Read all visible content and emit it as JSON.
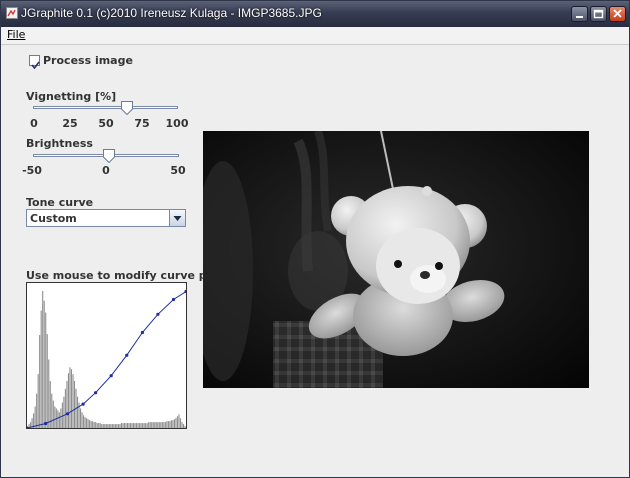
{
  "window": {
    "title": "JGraphite 0.1 (c)2010 Ireneusz Kulaga - IMGP3685.JPG"
  },
  "menu": {
    "file": "File"
  },
  "controls": {
    "process_image_label": "Process image",
    "process_image_checked": true,
    "vignetting": {
      "label": "Vignetting [%]",
      "value": 65,
      "min": 0,
      "max": 100,
      "ticks": [
        "0",
        "25",
        "50",
        "75",
        "100"
      ]
    },
    "brightness": {
      "label": "Brightness",
      "value": 2,
      "min": -50,
      "max": 50,
      "ticks": [
        "-50",
        "0",
        "50"
      ]
    },
    "tone_curve": {
      "label": "Tone curve",
      "selected": "Custom"
    },
    "curve_hint": "Use mouse to modify curve points."
  },
  "tone_curve_points": [
    [
      0,
      0
    ],
    [
      30,
      8
    ],
    [
      65,
      25
    ],
    [
      90,
      42
    ],
    [
      110,
      62
    ],
    [
      135,
      92
    ],
    [
      160,
      128
    ],
    [
      185,
      168
    ],
    [
      210,
      200
    ],
    [
      235,
      226
    ],
    [
      255,
      240
    ]
  ],
  "histogram": [
    0,
    4,
    6,
    10,
    15,
    22,
    35,
    55,
    95,
    120,
    140,
    130,
    118,
    96,
    70,
    48,
    35,
    28,
    22,
    20,
    18,
    16,
    20,
    26,
    32,
    40,
    48,
    56,
    62,
    60,
    55,
    48,
    40,
    32,
    26,
    20,
    16,
    13,
    11,
    10,
    9,
    8,
    7,
    7,
    6,
    6,
    5,
    5,
    5,
    4,
    4,
    4,
    4,
    4,
    4,
    4,
    4,
    4,
    4,
    4,
    4,
    4,
    5,
    5,
    5,
    5,
    5,
    5,
    5,
    5,
    5,
    5,
    5,
    5,
    5,
    5,
    5,
    5,
    5,
    5,
    6,
    6,
    6,
    6,
    6,
    6,
    6,
    6,
    6,
    6,
    6,
    6,
    7,
    7,
    7,
    8,
    8,
    9,
    10,
    12,
    14,
    10,
    6,
    4,
    2
  ],
  "image": {
    "description_alt": "IMGP3685.JPG"
  }
}
